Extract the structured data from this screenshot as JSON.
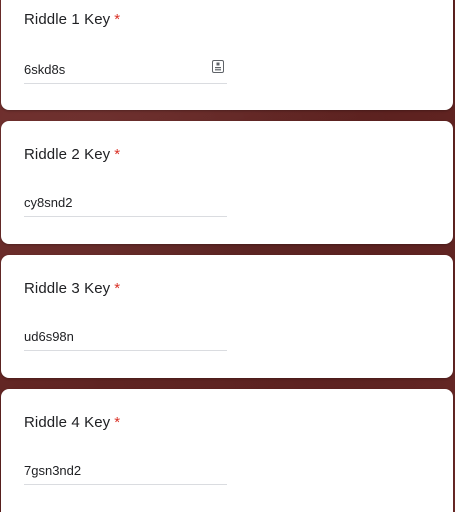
{
  "questions": [
    {
      "label": "Riddle 1 Key",
      "required_mark": "*",
      "value": "6skd8s",
      "has_key_icon": true
    },
    {
      "label": "Riddle 2 Key",
      "required_mark": "*",
      "value": "cy8snd2",
      "has_key_icon": false
    },
    {
      "label": "Riddle 3 Key",
      "required_mark": "*",
      "value": "ud6s98n",
      "has_key_icon": false
    },
    {
      "label": "Riddle 4 Key",
      "required_mark": "*",
      "value": "7gsn3nd2",
      "has_key_icon": false
    }
  ],
  "colors": {
    "background": "#6b2826",
    "card": "#ffffff",
    "required": "#d93025",
    "text": "#202124",
    "underline": "#dadce0"
  }
}
